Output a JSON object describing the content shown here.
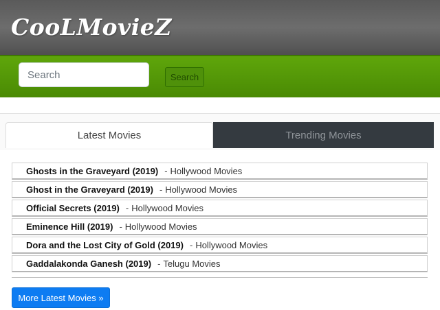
{
  "header": {
    "logo_text": "CooLMovieZ"
  },
  "search": {
    "placeholder": "Search",
    "value": "",
    "button_label": "Search"
  },
  "tabs": [
    {
      "label": "Latest Movies",
      "active": true
    },
    {
      "label": "Trending Movies",
      "active": false
    }
  ],
  "movies": [
    {
      "title": "Ghosts in the Graveyard (2019)",
      "separator": "-",
      "category": "Hollywood Movies"
    },
    {
      "title": "Ghost in the Graveyard (2019)",
      "separator": "-",
      "category": "Hollywood Movies"
    },
    {
      "title": "Official Secrets (2019)",
      "separator": "-",
      "category": "Hollywood Movies"
    },
    {
      "title": "Eminence Hill (2019)",
      "separator": "-",
      "category": "Hollywood Movies"
    },
    {
      "title": "Dora and the Lost City of Gold (2019)",
      "separator": "-",
      "category": "Hollywood Movies"
    },
    {
      "title": "Gaddalakonda Ganesh (2019)",
      "separator": "-",
      "category": "Telugu Movies"
    }
  ],
  "more_button": {
    "label": "More Latest Movies »"
  },
  "colors": {
    "header_bg": "#5a5a5a",
    "searchbar_bg": "#5fa60b",
    "tab_inactive_bg": "#343a40",
    "button_primary": "#0d7cf2"
  }
}
